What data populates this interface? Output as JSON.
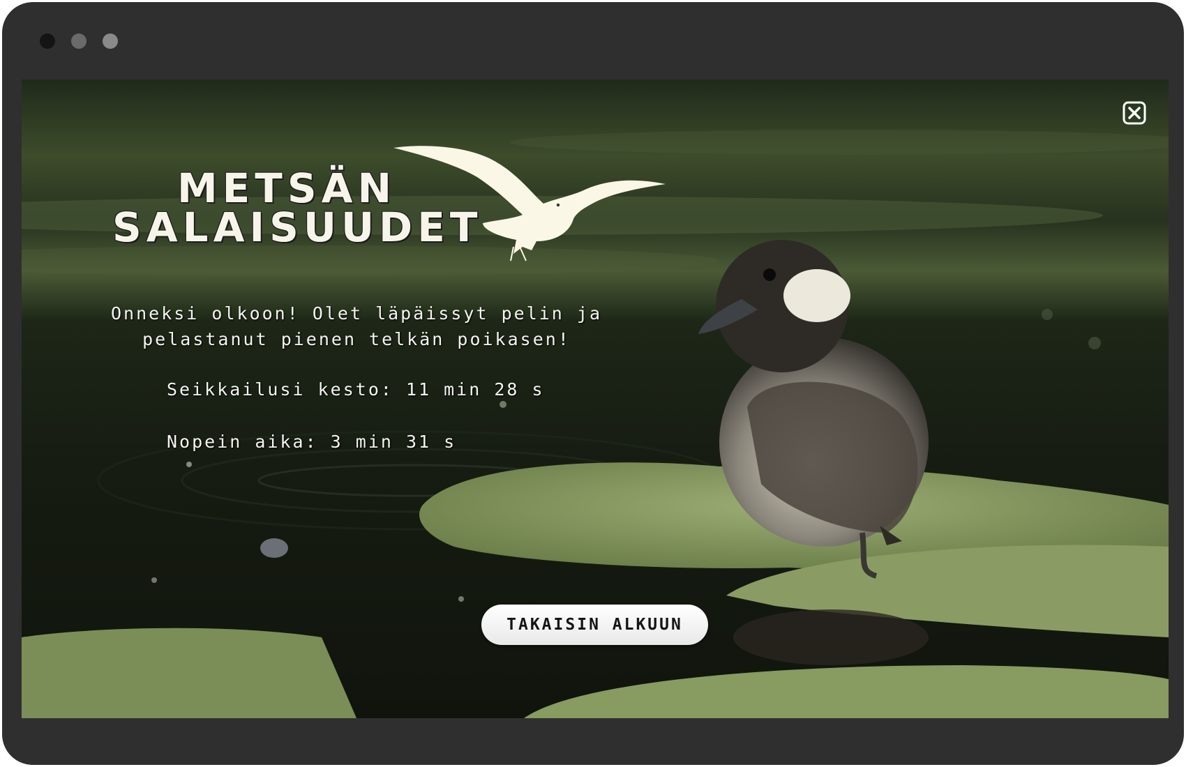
{
  "window": {
    "dot_colors": [
      "#141414",
      "#6a6a6a",
      "#8a8a8a"
    ]
  },
  "game": {
    "title_line1": "METSÄN",
    "title_line2": "SALAISUUDET",
    "logo_icon": "seagull-logo",
    "message": "Onneksi olkoon! Olet läpäissyt pelin ja pelastanut pienen telkän poikasen!",
    "duration_text": "Seikkailusi kesto: 11 min 28 s",
    "best_time_text": "Nopein aika: 3 min 31 s",
    "back_button_label": "TAKAISIN ALKUUN",
    "close_icon": "close-icon"
  },
  "colors": {
    "title": "#f7f5ea",
    "gull": "#fbf7e6",
    "button_bg": "#ffffff",
    "button_text": "#151515",
    "frame": "#2f2f2f"
  }
}
